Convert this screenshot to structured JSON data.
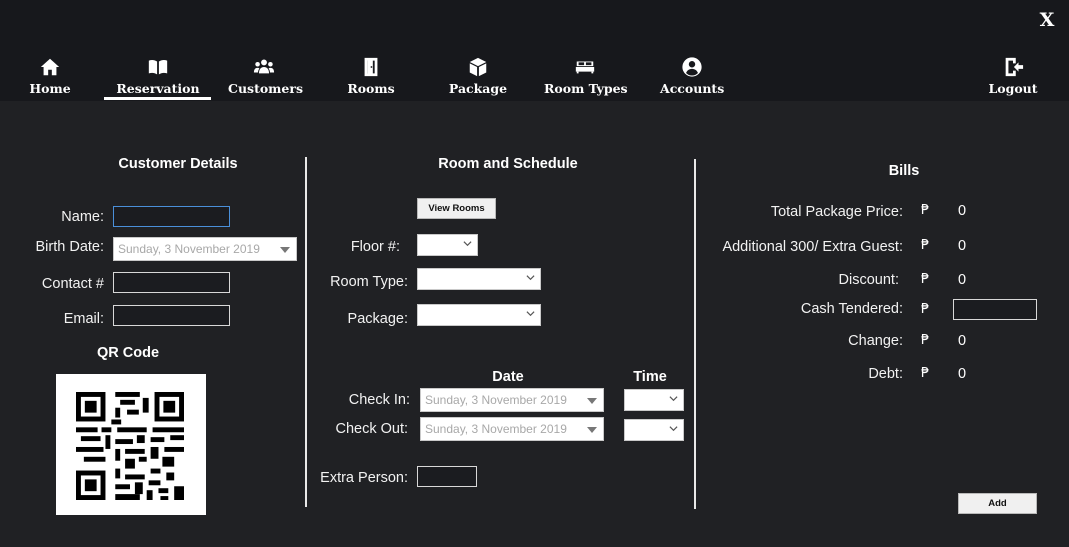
{
  "window": {
    "close_label": "X"
  },
  "nav": {
    "items": [
      {
        "label": "Home",
        "icon": "home-icon"
      },
      {
        "label": "Reservation",
        "icon": "book-open-icon"
      },
      {
        "label": "Customers",
        "icon": "users-icon"
      },
      {
        "label": "Rooms",
        "icon": "door-icon"
      },
      {
        "label": "Package",
        "icon": "box-icon"
      },
      {
        "label": "Room Types",
        "icon": "bed-icon"
      },
      {
        "label": "Accounts",
        "icon": "user-circle-icon"
      }
    ],
    "active": "Reservation",
    "logout_label": "Logout"
  },
  "customer": {
    "title": "Customer Details",
    "name_label": "Name:",
    "name_value": "",
    "birth_label": "Birth Date:",
    "birth_value": "Sunday, 3 November 2019",
    "contact_label": "Contact #",
    "contact_value": "",
    "email_label": "Email:",
    "email_value": "",
    "qr_title": "QR Code"
  },
  "room": {
    "title": "Room and Schedule",
    "view_rooms_label": "View Rooms",
    "floor_label": "Floor #:",
    "room_type_label": "Room Type:",
    "package_label": "Package:",
    "date_header": "Date",
    "time_header": "Time",
    "checkin_label": "Check In:",
    "checkin_date": "Sunday, 3 November 2019",
    "checkout_label": "Check Out:",
    "checkout_date": "Sunday, 3 November 2019",
    "extra_label": "Extra Person:"
  },
  "bills": {
    "title": "Bills",
    "currency": "₱",
    "rows": [
      {
        "label": "Total Package Price:",
        "value": "0"
      },
      {
        "label": "Additional 300/ Extra Guest:",
        "value": "0"
      },
      {
        "label": "Discount:",
        "value": "0"
      },
      {
        "label": "Cash Tendered:",
        "value": ""
      },
      {
        "label": "Change:",
        "value": "0"
      },
      {
        "label": "Debt:",
        "value": "0"
      }
    ],
    "add_label": "Add"
  },
  "colors": {
    "background": "#202124",
    "topbar": "#17181c",
    "focus": "#4a8fd9"
  }
}
